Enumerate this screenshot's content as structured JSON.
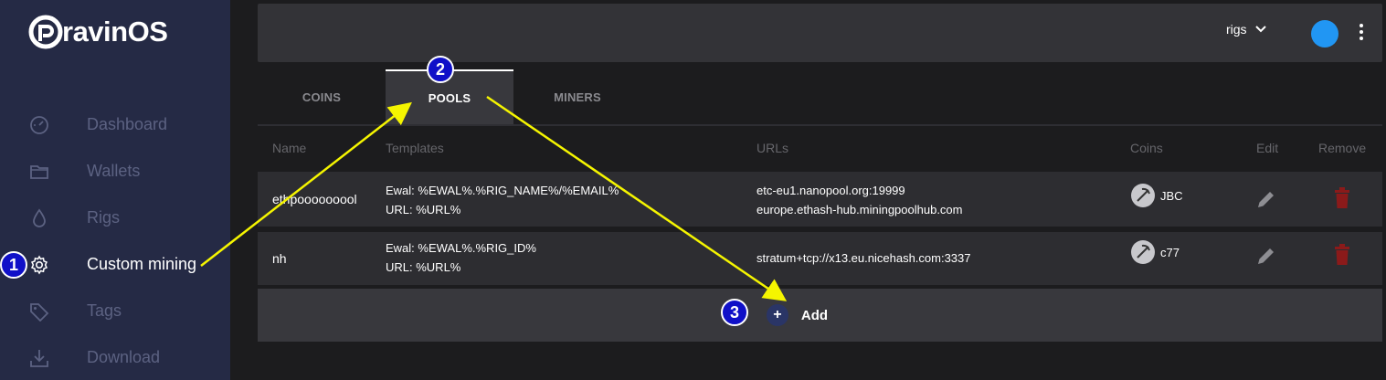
{
  "app": {
    "logo_text": "ravinOS"
  },
  "sidebar": {
    "items": [
      {
        "label": "Dashboard",
        "icon": "speedometer-icon"
      },
      {
        "label": "Wallets",
        "icon": "folder-icon"
      },
      {
        "label": "Rigs",
        "icon": "droplet-icon"
      },
      {
        "label": "Custom mining",
        "icon": "gear-icon",
        "active": true
      },
      {
        "label": "Tags",
        "icon": "tag-icon"
      },
      {
        "label": "Download",
        "icon": "download-icon"
      }
    ]
  },
  "topbar": {
    "rigs_label": "rigs"
  },
  "tabs": [
    {
      "label": "COINS"
    },
    {
      "label": "POOLS",
      "active": true
    },
    {
      "label": "MINERS"
    }
  ],
  "table": {
    "headers": [
      "Name",
      "Templates",
      "URLs",
      "Coins",
      "Edit",
      "Remove"
    ],
    "rows": [
      {
        "name": "ethpooooooool",
        "templates": [
          "Ewal: %EWAL%.%RIG_NAME%/%EMAIL%",
          "URL: %URL%"
        ],
        "urls": [
          "etc-eu1.nanopool.org:19999",
          "europe.ethash-hub.miningpoolhub.com"
        ],
        "coin": "JBC"
      },
      {
        "name": "nh",
        "templates": [
          "Ewal: %EWAL%.%RIG_ID%",
          "URL: %URL%"
        ],
        "urls": [
          "stratum+tcp://x13.eu.nicehash.com:3337"
        ],
        "coin": "c77"
      }
    ]
  },
  "add_button": {
    "symbol": "+",
    "label": "Add"
  },
  "annotations": {
    "markers": [
      "1",
      "2",
      "3"
    ],
    "arrow_color": "#f5f500",
    "marker_color": "#1010c8"
  },
  "colors": {
    "sidebar_bg": "#252a45",
    "delete_red": "#8b1a1a",
    "avatar": "#2196f3"
  }
}
